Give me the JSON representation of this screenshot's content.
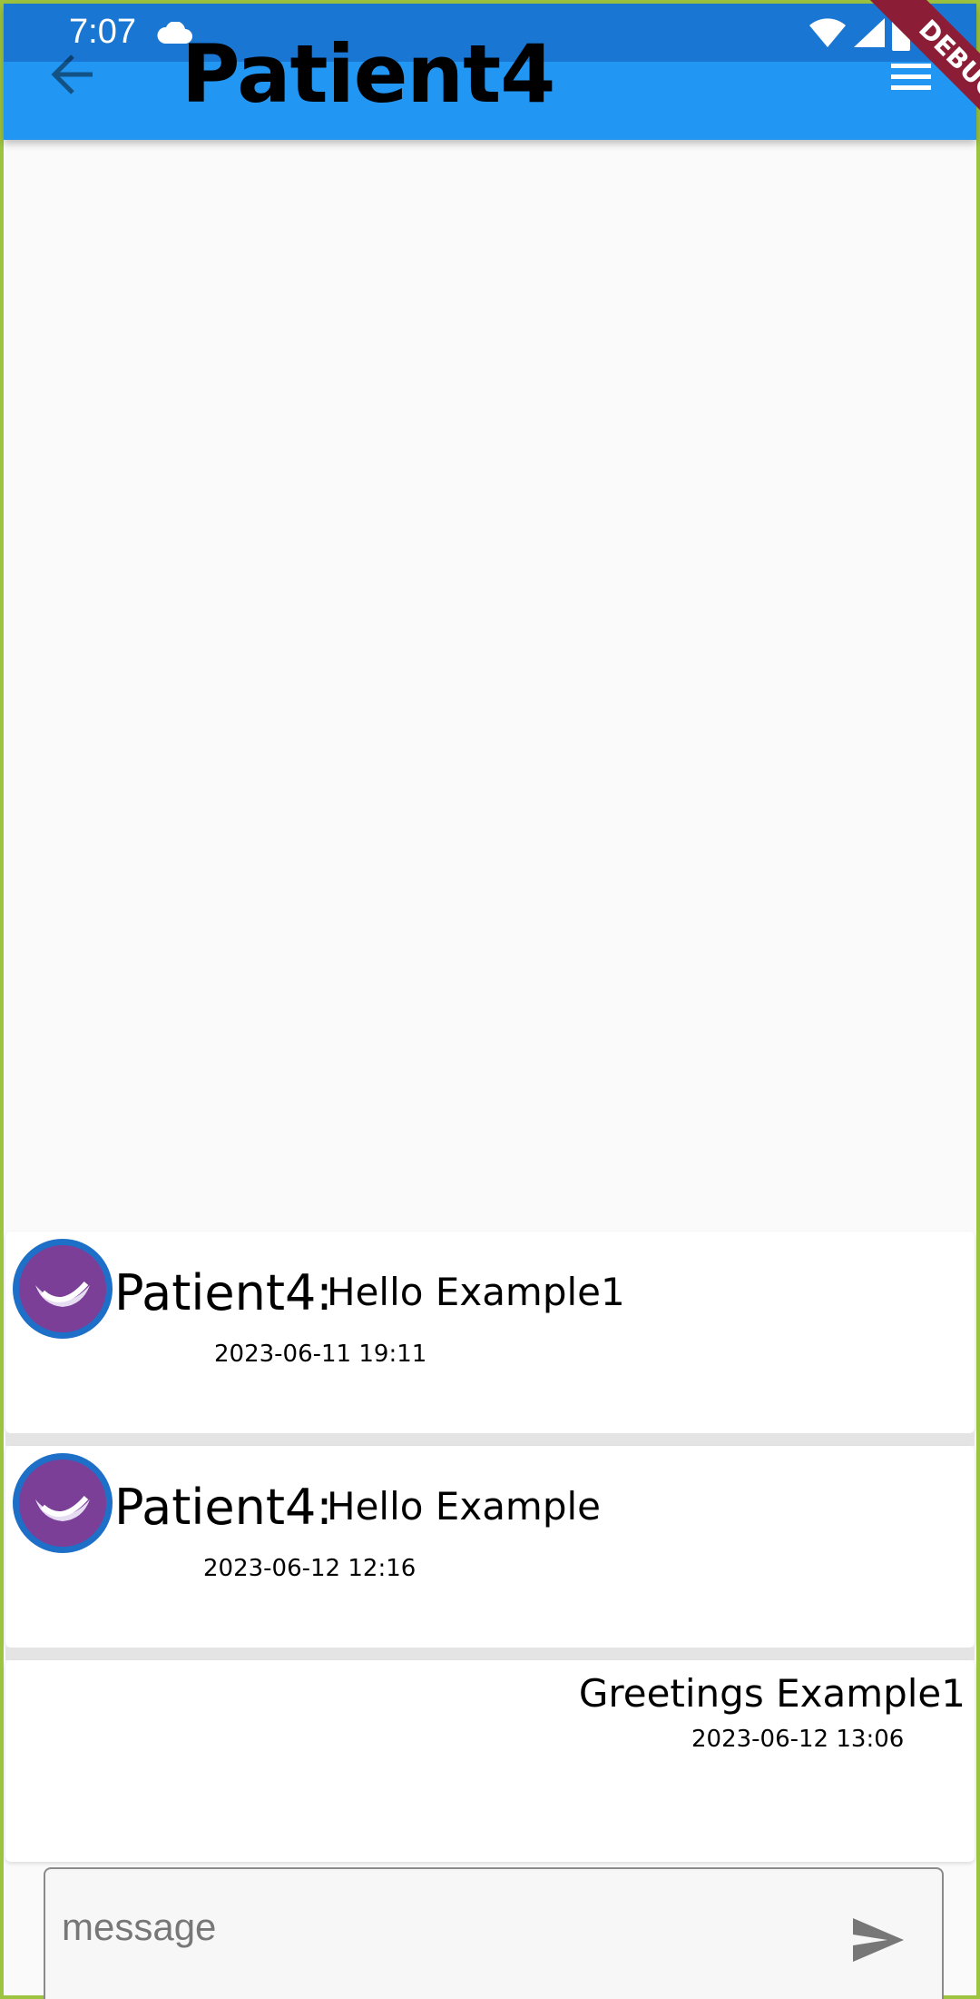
{
  "status_bar": {
    "time": "7:07"
  },
  "header": {
    "title": "Patient4",
    "debug_label": "DEBUG"
  },
  "messages": [
    {
      "sender": "Patient4:",
      "text": "Hello Example1",
      "timestamp": "2023-06-11 19:11"
    },
    {
      "sender": "Patient4:",
      "text": "Hello Example",
      "timestamp": "2023-06-12 12:16"
    },
    {
      "text": "Greetings Example1",
      "timestamp": "2023-06-12 13:06"
    }
  ],
  "composer": {
    "placeholder": "message",
    "value": ""
  },
  "colors": {
    "app_bar": "#2196f3",
    "status_bar": "#1976d2",
    "avatar_ring": "#1e6fc8",
    "avatar_fill": "#7b3f98",
    "debug_banner": "#8b1e36",
    "device_border": "#9dc440"
  },
  "icons": [
    "cloud-icon",
    "wifi-icon",
    "signal-icon",
    "battery-icon",
    "back-arrow-icon",
    "menu-icon",
    "send-icon"
  ]
}
